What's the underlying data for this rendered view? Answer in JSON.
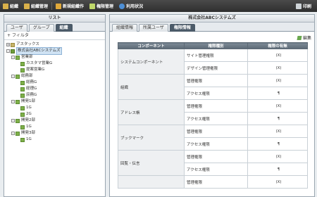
{
  "toolbar": {
    "items": [
      {
        "label": "組織",
        "icon": "org-icon",
        "color": "#d9b04a"
      },
      {
        "label": "組織管理",
        "icon": "org-manage-icon",
        "color": "#d9b04a"
      },
      {
        "label": "新規組織作",
        "icon": "new-org-icon",
        "color": "#e1a93a"
      },
      {
        "label": "権限管理",
        "icon": "permission-icon",
        "color": "#c0d86a"
      },
      {
        "label": "利用状況",
        "icon": "info-icon",
        "color": "#4d8fd6"
      }
    ],
    "print_label": "印刷"
  },
  "left": {
    "title": "リスト",
    "tabs": [
      "ユーザ",
      "グループ",
      "組織"
    ],
    "active_tab": "組織",
    "filter_label": "フィルタ",
    "tree": [
      {
        "label": "アスタックス",
        "level": 0,
        "toggle": "+",
        "icon": "folder"
      },
      {
        "label": "株式会社ABCシステムズ",
        "level": 0,
        "toggle": "-",
        "icon": "org",
        "selected": true
      },
      {
        "label": "営業部",
        "level": 1,
        "toggle": "-",
        "icon": "grp"
      },
      {
        "label": "カスタマ営業G",
        "level": 2,
        "toggle": "",
        "icon": "grp"
      },
      {
        "label": "提案営業G",
        "level": 2,
        "toggle": "",
        "icon": "grp"
      },
      {
        "label": "総務部",
        "level": 1,
        "toggle": "-",
        "icon": "grp"
      },
      {
        "label": "総務G",
        "level": 2,
        "toggle": "",
        "icon": "grp"
      },
      {
        "label": "経理G",
        "level": 2,
        "toggle": "",
        "icon": "grp"
      },
      {
        "label": "庶務G",
        "level": 2,
        "toggle": "",
        "icon": "grp"
      },
      {
        "label": "開発1部",
        "level": 1,
        "toggle": "-",
        "icon": "grp"
      },
      {
        "label": "1G",
        "level": 2,
        "toggle": "",
        "icon": "grp"
      },
      {
        "label": "2G",
        "level": 2,
        "toggle": "",
        "icon": "grp"
      },
      {
        "label": "開発2部",
        "level": 1,
        "toggle": "-",
        "icon": "grp"
      },
      {
        "label": "1G",
        "level": 2,
        "toggle": "",
        "icon": "grp"
      },
      {
        "label": "開発3部",
        "level": 1,
        "toggle": "-",
        "icon": "grp"
      },
      {
        "label": "1G",
        "level": 2,
        "toggle": "",
        "icon": "grp"
      }
    ]
  },
  "right": {
    "title": "株式会社ABCシステムズ",
    "tabs": [
      "組織情報",
      "所属ユーザ",
      "権限情報"
    ],
    "active_tab": "権限情報",
    "edit_label": "編集",
    "table": {
      "headers": [
        "コンポーネント",
        "権限種別",
        "権限の有無"
      ],
      "rows": [
        {
          "component": "システムコンポーネント",
          "kind": "サイト管理権限",
          "value": "(X)"
        },
        {
          "component": "",
          "kind": "デザイン管理権限",
          "value": "(X)"
        },
        {
          "component": "組織",
          "kind": "管理権限",
          "value": "(X)"
        },
        {
          "component": "",
          "kind": "アクセス権限",
          "value": "¶"
        },
        {
          "component": "アドレス帳",
          "kind": "管理権限",
          "value": "(X)"
        },
        {
          "component": "",
          "kind": "アクセス権限",
          "value": "¶"
        },
        {
          "component": "ブックマーク",
          "kind": "管理権限",
          "value": "(X)"
        },
        {
          "component": "",
          "kind": "アクセス権限",
          "value": "¶"
        },
        {
          "component": "回覧・伝言",
          "kind": "管理権限",
          "value": "(X)"
        },
        {
          "component": "",
          "kind": "アクセス権限",
          "value": "¶"
        },
        {
          "component": "",
          "kind": "管理権限",
          "value": "(X)"
        }
      ]
    }
  }
}
